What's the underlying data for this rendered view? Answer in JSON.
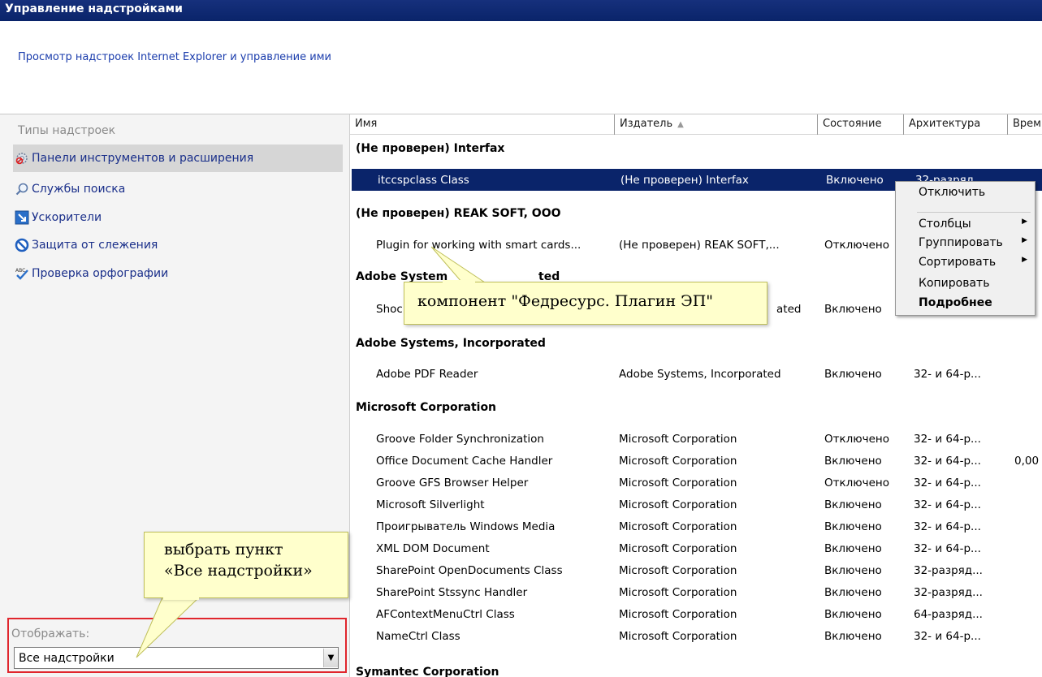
{
  "window": {
    "title": "Управление надстройками",
    "description": "Просмотр надстроек Internet Explorer и управление ими"
  },
  "sidebar": {
    "types_label": "Типы надстроек",
    "items": [
      {
        "label": "Панели инструментов и расширения",
        "icon": "gear-icon",
        "selected": true
      },
      {
        "label": "Службы поиска",
        "icon": "search-icon",
        "selected": false
      },
      {
        "label": "Ускорители",
        "icon": "accelerator-icon",
        "selected": false
      },
      {
        "label": "Защита от слежения",
        "icon": "tracking-protection-icon",
        "selected": false
      },
      {
        "label": "Проверка орфографии",
        "icon": "spelling-icon",
        "selected": false
      }
    ],
    "show_label": "Отображать:",
    "show_value": "Все надстройки"
  },
  "list": {
    "columns": [
      "Имя",
      "Издатель",
      "Состояние",
      "Архитектура",
      "Врем"
    ],
    "sort_icon": "sort-up-icon",
    "groups": [
      {
        "title": "(Не проверен) Interfax"
      },
      {
        "title": "(Не проверен) REAK SOFT, OOO"
      },
      {
        "title": "Adobe Systems, Incorporated (partial)",
        "visible_left": "Adobe System",
        "visible_right": "ted"
      },
      {
        "title": "Adobe Systems, Incorporated"
      },
      {
        "title": "Microsoft Corporation"
      },
      {
        "title": "Symantec Corporation"
      }
    ],
    "rows": [
      {
        "name": "itccspclass Class",
        "publisher": "(Не проверен) Interfax",
        "state": "Включено",
        "arch": "32-разряд...",
        "time": ""
      },
      {
        "name": "Plugin for working with smart cards...",
        "publisher": "(Не проверен) REAK SOFT,...",
        "state": "Отключено",
        "arch": "",
        "time": ""
      },
      {
        "name": "Shoc",
        "publisher": "ated",
        "state": "Включено",
        "arch": "",
        "time": ""
      },
      {
        "name": "Adobe PDF Reader",
        "publisher": "Adobe Systems, Incorporated",
        "state": "Включено",
        "arch": "32- и 64-р...",
        "time": ""
      },
      {
        "name": "Groove Folder Synchronization",
        "publisher": "Microsoft Corporation",
        "state": "Отключено",
        "arch": "32- и 64-р...",
        "time": ""
      },
      {
        "name": "Office Document Cache Handler",
        "publisher": "Microsoft Corporation",
        "state": "Включено",
        "arch": "32- и 64-р...",
        "time": "0,00"
      },
      {
        "name": "Groove GFS Browser Helper",
        "publisher": "Microsoft Corporation",
        "state": "Отключено",
        "arch": "32- и 64-р...",
        "time": ""
      },
      {
        "name": "Microsoft Silverlight",
        "publisher": "Microsoft Corporation",
        "state": "Включено",
        "arch": "32- и 64-р...",
        "time": ""
      },
      {
        "name": "Проигрыватель Windows Media",
        "publisher": "Microsoft Corporation",
        "state": "Включено",
        "arch": "32- и 64-р...",
        "time": ""
      },
      {
        "name": "XML DOM Document",
        "publisher": "Microsoft Corporation",
        "state": "Включено",
        "arch": "32- и 64-р...",
        "time": ""
      },
      {
        "name": "SharePoint OpenDocuments Class",
        "publisher": "Microsoft Corporation",
        "state": "Включено",
        "arch": "32-разряд...",
        "time": ""
      },
      {
        "name": "SharePoint Stssync Handler",
        "publisher": "Microsoft Corporation",
        "state": "Включено",
        "arch": "32-разряд...",
        "time": ""
      },
      {
        "name": "AFContextMenuCtrl Class",
        "publisher": "Microsoft Corporation",
        "state": "Включено",
        "arch": "64-разряд...",
        "time": ""
      },
      {
        "name": "NameCtrl Class",
        "publisher": "Microsoft Corporation",
        "state": "Включено",
        "arch": "32- и 64-р...",
        "time": ""
      }
    ]
  },
  "context_menu": {
    "items": [
      {
        "label": "Отключить",
        "submenu": false,
        "bold": false
      },
      {
        "label": "Столбцы",
        "submenu": true,
        "bold": false
      },
      {
        "label": "Группировать",
        "submenu": true,
        "bold": false
      },
      {
        "label": "Сортировать",
        "submenu": true,
        "bold": false
      },
      {
        "label": "Копировать",
        "submenu": false,
        "bold": false
      },
      {
        "label": "Подробнее",
        "submenu": false,
        "bold": true
      }
    ]
  },
  "callouts": {
    "plugin_note": "компонент \"Федресурс. Плагин ЭП\"",
    "select_note_line1": "выбрать пункт",
    "select_note_line2": "«Все надстройки»"
  },
  "colors": {
    "titlebar": "#0a246a",
    "selection": "#0a246a",
    "link": "#1a2f8a",
    "callout_bg": "#ffffcc",
    "highlight_border": "#e0262d"
  }
}
